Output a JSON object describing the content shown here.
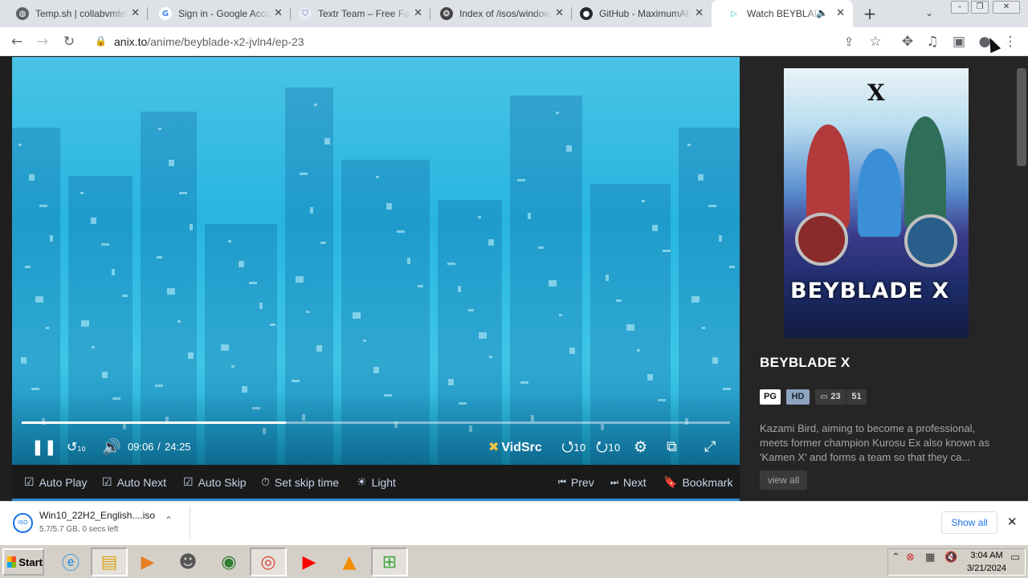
{
  "browser": {
    "tabs": [
      {
        "title": "Temp.sh | collabvmteam",
        "icon": "globe-icon",
        "active": false
      },
      {
        "title": "Sign in - Google Accounts",
        "icon": "google-icon",
        "active": false
      },
      {
        "title": "Textr Team – Free Fake",
        "icon": "shield-icon",
        "active": false
      },
      {
        "title": "Index of /isos/windows",
        "icon": "sphere-icon",
        "active": false
      },
      {
        "title": "GitHub - MaximumADHD",
        "icon": "github-icon",
        "active": false
      },
      {
        "title": "Watch BEYBLADE X",
        "icon": "play-icon",
        "active": true,
        "audio": true
      }
    ],
    "url_host": "anix.to",
    "url_path": "/anime/beyblade-x2-jvln4/ep-23"
  },
  "player": {
    "time_current": "09:06",
    "time_separator": "/",
    "time_total": "24:25",
    "progress_fraction": 0.373,
    "source_label": "VidSrc",
    "rewind_label": "10",
    "forward_label": "10"
  },
  "options": {
    "auto_play": "Auto Play",
    "auto_next": "Auto Next",
    "auto_skip": "Auto Skip",
    "set_skip_time": "Set skip time",
    "light": "Light",
    "prev": "Prev",
    "next": "Next",
    "bookmark": "Bookmark"
  },
  "anime": {
    "poster_title": "BEYBLADE X",
    "poster_x": "X",
    "title": "BEYBLADE X",
    "rating": "PG",
    "quality": "HD",
    "sub_count": "23",
    "episode_count": "51",
    "description": "Kazami Bird, aiming to become a professional, meets former champion Kurosu Ex also known as 'Kamen X' and forms a team so that they ca...",
    "view_all": "view all"
  },
  "download": {
    "file_name": "Win10_22H2_English....iso",
    "status": "5.7/5.7 GB, 0 secs left",
    "show_all": "Show all"
  },
  "taskbar": {
    "start_label": "Start",
    "time": "3:04 AM",
    "date": "3/21/2024"
  },
  "colors": {
    "accent_blue": "#2f84c9",
    "player_cyan": "#27b5e0",
    "sidebar_bg": "#252525",
    "badge_hd": "#8ea3bf"
  }
}
